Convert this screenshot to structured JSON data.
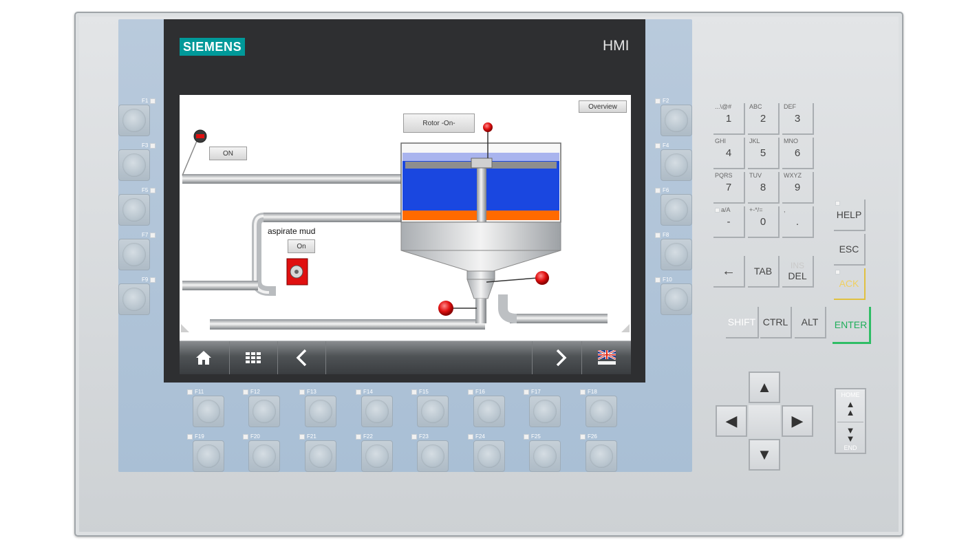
{
  "device": {
    "brand": "SIEMENS",
    "model_label": "HMI"
  },
  "screen": {
    "overview_button": "Overview",
    "rotor_button": "Rotor -On-",
    "on_button_top": "ON",
    "aspirate_label": "aspirate mud",
    "on_button_aspirate": "On",
    "nav": {
      "home_icon": "home-icon",
      "menu_icon": "menu-grid-icon",
      "back_icon": "chevron-left-icon",
      "forward_icon": "chevron-right-icon",
      "language_icon": "uk-flag-icon"
    },
    "colors": {
      "water": "#1a47e0",
      "sludge_layer": "#ff6a00",
      "alarm_red": "#e01010",
      "siemens_teal": "#009999"
    }
  },
  "function_keys": {
    "left_column": [
      {
        "label": "F1"
      },
      {
        "label": "F3"
      },
      {
        "label": "F5"
      },
      {
        "label": "F7"
      },
      {
        "label": "F9"
      }
    ],
    "right_column": [
      {
        "label": "F2"
      },
      {
        "label": "F4"
      },
      {
        "label": "F6"
      },
      {
        "label": "F8"
      },
      {
        "label": "F10"
      }
    ],
    "bottom_row_1": [
      {
        "label": "F11"
      },
      {
        "label": "F12"
      },
      {
        "label": "F13"
      },
      {
        "label": "F14"
      },
      {
        "label": "F15"
      },
      {
        "label": "F16"
      },
      {
        "label": "F17"
      },
      {
        "label": "F18"
      }
    ],
    "bottom_row_2": [
      {
        "label": "F19"
      },
      {
        "label": "F20"
      },
      {
        "label": "F21"
      },
      {
        "label": "F22"
      },
      {
        "label": "F23"
      },
      {
        "label": "F24"
      },
      {
        "label": "F25"
      },
      {
        "label": "F26"
      }
    ]
  },
  "keypad": [
    {
      "sub": "...\\@#",
      "main": "1"
    },
    {
      "sub": "ABC",
      "main": "2"
    },
    {
      "sub": "DEF",
      "main": "3"
    },
    {
      "sub": "GHI",
      "main": "4"
    },
    {
      "sub": "JKL",
      "main": "5"
    },
    {
      "sub": "MNO",
      "main": "6"
    },
    {
      "sub": "PQRS",
      "main": "7"
    },
    {
      "sub": "TUV",
      "main": "8"
    },
    {
      "sub": "WXYZ",
      "main": "9"
    },
    {
      "sub": "a/A",
      "main": "-"
    },
    {
      "sub": "+-*/=",
      "main": "0"
    },
    {
      "sub": ",",
      "main": "."
    }
  ],
  "command_keys": {
    "help": "HELP",
    "esc": "ESC",
    "backspace": "←",
    "tab": "TAB",
    "ins": "INS",
    "del": "DEL",
    "ack": "ACK",
    "shift": "SHIFT",
    "ctrl": "CTRL",
    "alt": "ALT",
    "enter": "ENTER",
    "home": "HOME",
    "end": "END"
  },
  "arrows": {
    "up": "▲",
    "down": "▼",
    "left": "◀",
    "right": "▶",
    "page_up": "▲",
    "page_down": "▼"
  }
}
